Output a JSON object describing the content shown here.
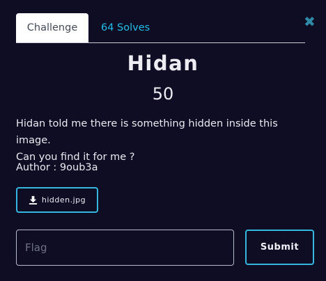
{
  "modal": {
    "close_icon": "close-icon",
    "accent_color": "#34b8e0"
  },
  "tabs": [
    {
      "label": "Challenge",
      "active": true
    },
    {
      "label": "64 Solves",
      "active": false
    }
  ],
  "challenge": {
    "name": "Hidan",
    "points": "50",
    "description_line1": "Hidan told me there is something hidden inside this image.",
    "description_line2": "Can you find it for me ?",
    "author": "Author : 9oub3a",
    "file": {
      "name": "hidden.jpg",
      "icon": "download-icon"
    }
  },
  "submission": {
    "flag_placeholder": "Flag",
    "flag_value": "",
    "submit_label": "Submit"
  }
}
